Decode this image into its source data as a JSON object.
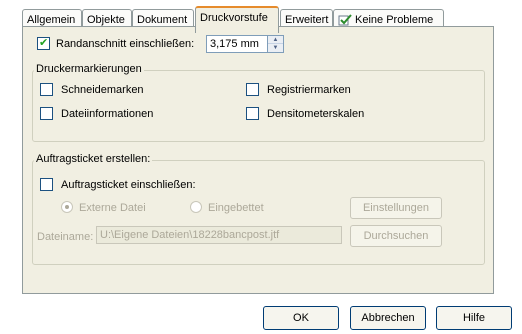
{
  "tabs": [
    {
      "label": "Allgemein",
      "active": false
    },
    {
      "label": "Objekte",
      "active": false
    },
    {
      "label": "Dokument",
      "active": false
    },
    {
      "label": "Druckvorstufe",
      "active": true
    },
    {
      "label": "Erweitert",
      "active": false
    },
    {
      "label": "Keine Probleme",
      "active": false,
      "icon": "check-document-icon"
    }
  ],
  "bleed": {
    "label": "Randanschnitt einschließen:",
    "checked": true,
    "value": "3,175 mm"
  },
  "printer_marks": {
    "title": "Druckermarkierungen",
    "items": [
      {
        "label": "Schneidemarken",
        "checked": false
      },
      {
        "label": "Registriermarken",
        "checked": false
      },
      {
        "label": "Dateiinformationen",
        "checked": false
      },
      {
        "label": "Densitometerskalen",
        "checked": false
      }
    ]
  },
  "job_ticket": {
    "title": "Auftragsticket erstellen:",
    "include_label": "Auftragsticket einschließen:",
    "include_checked": false,
    "radio_external": "Externe Datei",
    "radio_embedded": "Eingebettet",
    "settings_button": "Einstellungen",
    "filename_label": "Dateiname:",
    "filename_value": "U:\\Eigene Dateien\\18228bancpost.jtf",
    "browse_button": "Durchsuchen"
  },
  "buttons": {
    "ok": "OK",
    "cancel": "Abbrechen",
    "help": "Hilfe"
  },
  "colors": {
    "panel_bg": "#f1efe2",
    "active_tab_accent": "#e68b2c",
    "border": "#919b9c",
    "disabled_text": "#aca899"
  }
}
